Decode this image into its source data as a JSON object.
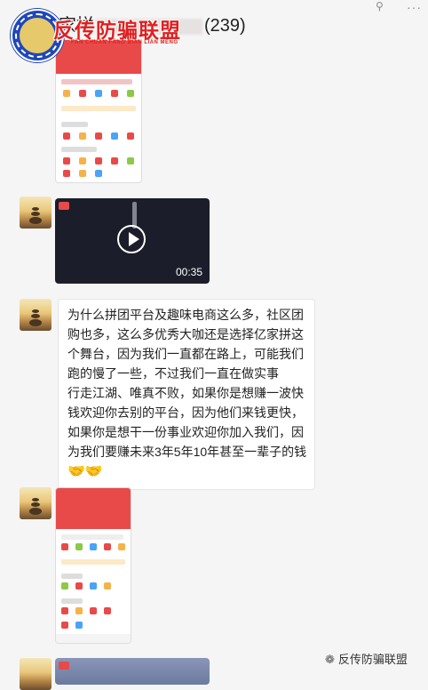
{
  "titlebar": {
    "title_prefix": "家拼",
    "member_count": "(239)",
    "pin_icon": "pin-icon",
    "more_icon": "more-dots-icon"
  },
  "overlay": {
    "banner_big": "反传防骗联盟",
    "banner_small": "FĂN CHUẨN FĂNG BIĂN LIÁN MÉNG"
  },
  "messages": [
    {
      "type": "image",
      "desc": "app-screenshot"
    },
    {
      "type": "video",
      "duration": "00:35"
    },
    {
      "type": "text",
      "lines": [
        "为什么拼团平台及趣味电商这么多，社区团",
        "购也多，这么多优秀大咖还是选择亿家拼这",
        "个舞台，因为我们一直都在路上，可能我们",
        "跑的慢了一些，不过我们一直在做实事",
        "行走江湖、唯真不败，如果你是想赚一波快",
        "钱欢迎你去别的平台，因为他们来钱更快，",
        "如果你是想干一份事业欢迎你加入我们，因",
        "为我们要赚未来3年5年10年甚至一辈子的钱"
      ],
      "emoji": "🤝🤝"
    },
    {
      "type": "image",
      "desc": "app-screenshot"
    },
    {
      "type": "image",
      "desc": "partial-image"
    }
  ],
  "watermark": {
    "text": "反传防骗联盟"
  },
  "colors": {
    "accent_red": "#e84a4a",
    "logo_blue": "#1f47b8"
  }
}
